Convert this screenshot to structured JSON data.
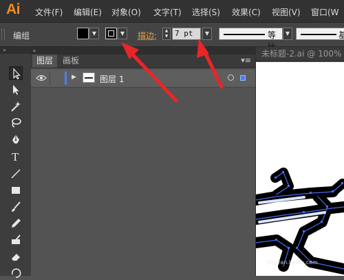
{
  "app": {
    "logo": "Ai"
  },
  "menu": [
    {
      "label": "文件(F)"
    },
    {
      "label": "编辑(E)"
    },
    {
      "label": "对象(O)"
    },
    {
      "label": "文字(T)"
    },
    {
      "label": "选择(S)"
    },
    {
      "label": "效果(C)"
    },
    {
      "label": "视图(V)"
    },
    {
      "label": "窗口(W"
    }
  ],
  "control": {
    "selection_type": "编组",
    "stroke_label": "描边:",
    "stroke_weight": "7 pt",
    "profile_1_label": "等比",
    "profile_2_label": "基"
  },
  "tools": [
    "selection-tool-icon",
    "direct-selection-tool-icon",
    "magic-wand-tool-icon",
    "lasso-tool-icon",
    "pen-tool-icon",
    "type-tool-icon",
    "line-tool-icon",
    "rectangle-tool-icon",
    "paintbrush-tool-icon",
    "pencil-tool-icon",
    "blob-brush-tool-icon",
    "eraser-tool-icon"
  ],
  "panel": {
    "tabs": [
      {
        "label": "图层",
        "active": true
      },
      {
        "label": "画板",
        "active": false
      }
    ],
    "layers": [
      {
        "name": "图层 1",
        "color": "#4f7cf0"
      }
    ]
  },
  "document": {
    "tab_title": "未标题-2.ai @ 100%"
  },
  "watermark": {
    "line1": "jingyan.baidu.com"
  },
  "colors": {
    "accent": "#f28c20",
    "layer": "#4f7cf0",
    "annotation_arrow": "#e8262a"
  }
}
